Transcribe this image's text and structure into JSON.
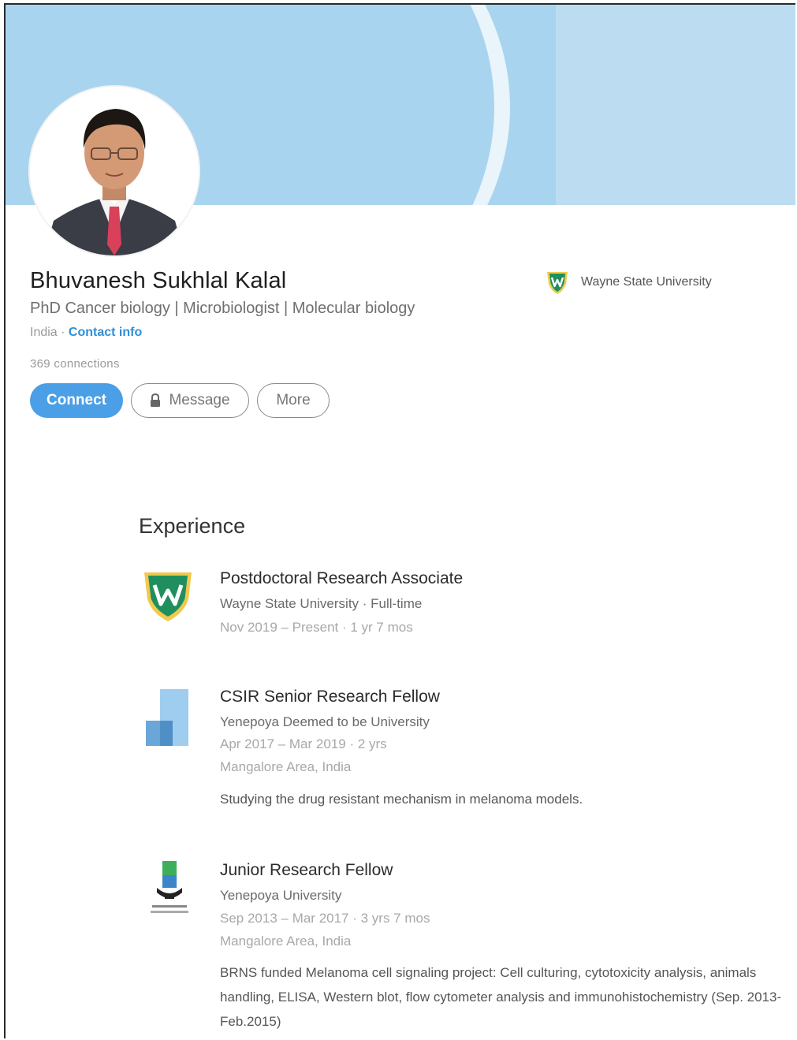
{
  "profile": {
    "name": "Bhuvanesh Sukhlal Kalal",
    "headline": "PhD Cancer biology | Microbiologist | Molecular biology",
    "location": "India",
    "separator": " · ",
    "contact_info": "Contact info",
    "connections": "369 connections",
    "current_school": "Wayne State University"
  },
  "actions": {
    "connect": "Connect",
    "message": "Message",
    "more": "More"
  },
  "experience": {
    "heading": "Experience",
    "items": [
      {
        "title": "Postdoctoral Research Associate",
        "company": "Wayne State University · Full-time",
        "dates": "Nov 2019 – Present · 1 yr 7 mos"
      },
      {
        "title": "CSIR Senior Research Fellow",
        "company": "Yenepoya Deemed to be University",
        "dates": "Apr 2017 – Mar 2019 · 2 yrs",
        "location": "Mangalore Area, India",
        "description": "Studying the drug resistant mechanism in melanoma models."
      },
      {
        "title": "Junior Research Fellow",
        "company": "Yenepoya University",
        "dates": "Sep 2013 – Mar 2017 · 3 yrs 7 mos",
        "location": "Mangalore Area, India",
        "description": "BRNS funded Melanoma cell signaling project: Cell culturing, cytotoxicity analysis, animals handling, ELISA, Western blot, flow cytometer analysis and immunohistochemistry (Sep. 2013-Feb.2015)"
      }
    ]
  },
  "icons": {
    "lock": "lock-icon",
    "wayne_state": "wayne-state-logo-icon",
    "yenepoya_deemed": "yenepoya-deemed-logo-icon",
    "yenepoya": "yenepoya-university-logo-icon"
  },
  "colors": {
    "banner": "#a9d4ef",
    "accent": "#4a9fe6",
    "link": "#2e8fd6",
    "wayne_green": "#1f8f5f",
    "wayne_gold": "#f2c94c"
  }
}
